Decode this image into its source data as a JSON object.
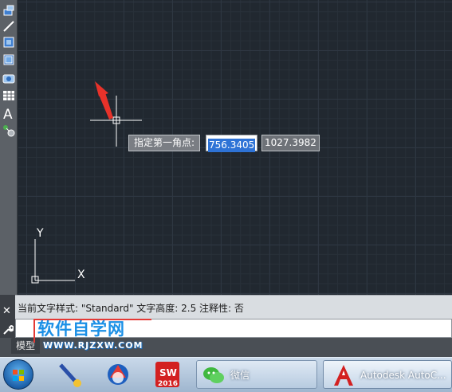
{
  "canvas": {
    "ucs_y_label": "Y",
    "ucs_x_label": "X"
  },
  "dynamic_input": {
    "prompt": "指定第一角点:",
    "x_value": "756.3405",
    "y_value": "1027.3982"
  },
  "command": {
    "history_line": "当前文字样式: \"Standard\"  文字高度:  2.5  注释性:  否"
  },
  "tabs": {
    "model": "模型"
  },
  "watermark": {
    "title": "软件自学网",
    "url": "WWW.RJZXW.COM"
  },
  "taskbar": {
    "wechat_label": "微信",
    "autocad_label": "Autodesk AutoC...",
    "sw_version": "2016"
  },
  "colors": {
    "canvas_bg": "#212830",
    "grid_major": "#2e3742",
    "crosshair": "#ffffff",
    "arrow": "#e8322a",
    "selection": "#2e73d6",
    "watermark_blue": "#1a8fe6"
  },
  "icons": {
    "toolbar": [
      "insert-block-icon",
      "line-icon",
      "region-icon",
      "region-2-icon",
      "camera-icon",
      "table-icon",
      "text-icon",
      "multileader-icon"
    ]
  }
}
